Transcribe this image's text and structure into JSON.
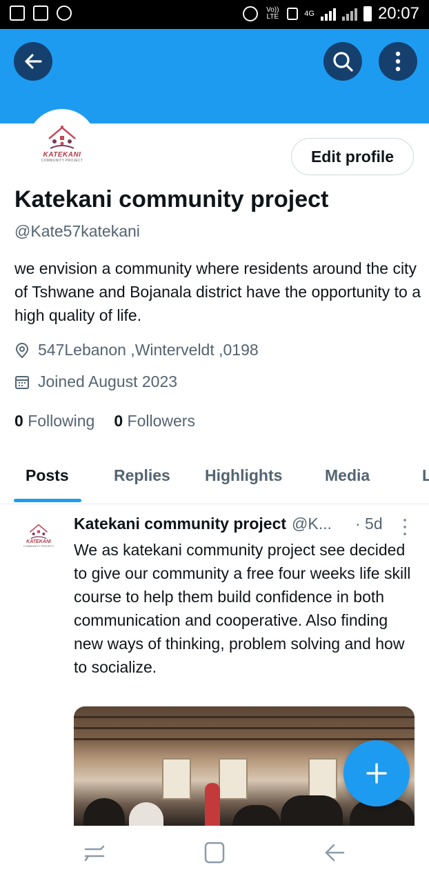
{
  "status_bar": {
    "time": "20:07",
    "network": "4G",
    "volte": "Vo)) LTE"
  },
  "header": {
    "back_icon": "arrow-left-icon",
    "search_icon": "search-icon",
    "more_icon": "more-vertical-icon"
  },
  "profile": {
    "logo_text": "KATEKANI",
    "logo_subtext": "COMMUNITY PROJECT",
    "edit_label": "Edit profile",
    "name": "Katekani community project",
    "handle": "@Kate57katekani",
    "bio": "we envision a community where residents around the city of Tshwane  and Bojanala district have the opportunity to a high quality of life.",
    "location": "547Lebanon ,Winterveldt ,0198",
    "joined": "Joined August 2023",
    "following_count": "0",
    "following_label": "Following",
    "followers_count": "0",
    "followers_label": "Followers"
  },
  "tabs": [
    {
      "label": "Posts",
      "active": true
    },
    {
      "label": "Replies",
      "active": false
    },
    {
      "label": "Highlights",
      "active": false
    },
    {
      "label": "Media",
      "active": false
    },
    {
      "label": "L",
      "active": false
    }
  ],
  "post": {
    "author": "Katekani community project",
    "handle": "@K...",
    "time": "· 5d",
    "text": "We as katekani community project see decided to give our community a free four weeks life skill course to help them build confidence in both communication and cooperative. Also  finding new ways of thinking, problem solving and how to socialize."
  },
  "fab": {
    "icon": "plus-icon"
  },
  "colors": {
    "accent": "#1d9bf0",
    "header_button": "#15406e",
    "text_primary": "#0f1419",
    "text_secondary": "#536471"
  }
}
